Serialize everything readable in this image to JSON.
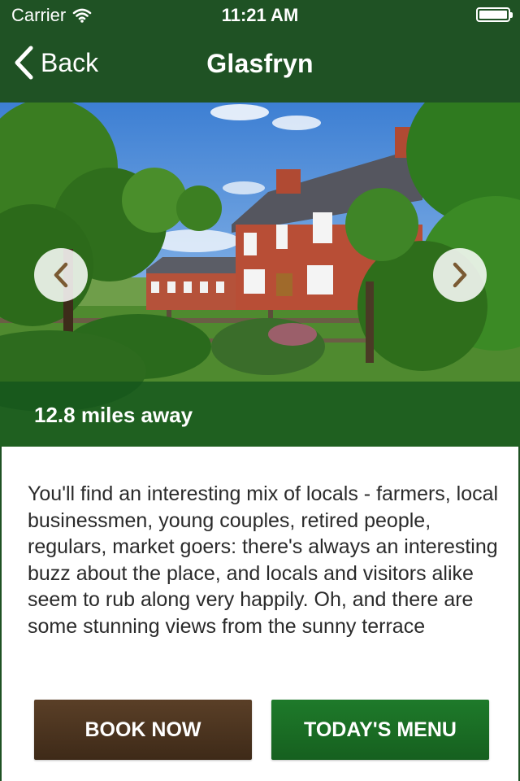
{
  "status_bar": {
    "carrier": "Carrier",
    "time": "11:21 AM"
  },
  "nav": {
    "back_label": "Back",
    "title": "Glasfryn"
  },
  "hero": {
    "distance": "12.8 miles away",
    "prev_icon": "chevron-left-icon",
    "next_icon": "chevron-right-icon"
  },
  "content": {
    "description": "You'll find an interesting mix of locals - farmers, local businessmen, young couples, retired people, regulars, market goers: there's always an interesting buzz about the place, and locals and visitors alike seem to rub along very happily. Oh, and there are some stunning views from the sunny terrace"
  },
  "actions": {
    "book_label": "BOOK NOW",
    "menu_label": "TODAY'S MENU"
  },
  "colors": {
    "brand_green": "#1f5224",
    "book_brown": "#4b3420",
    "menu_green": "#1a6d25"
  }
}
